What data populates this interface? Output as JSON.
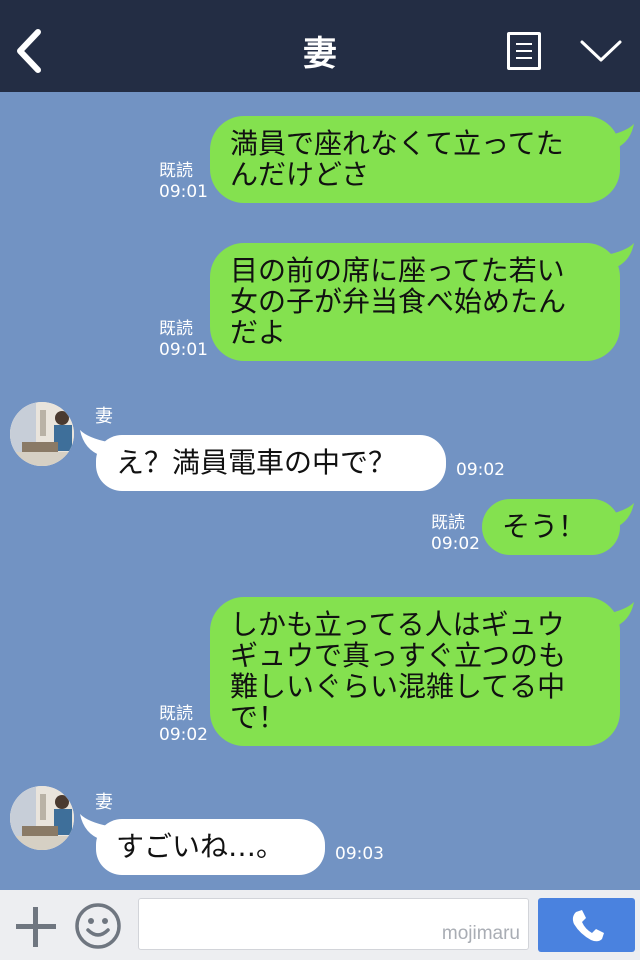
{
  "header": {
    "title": "妻",
    "icons": [
      "back-arrow-icon",
      "notes-icon",
      "chevron-down-icon"
    ]
  },
  "messages": [
    {
      "side": "out",
      "lines": [
        "満員で座れなくて立ってた",
        "んだけどさ"
      ],
      "read": "既読",
      "time": "09:01"
    },
    {
      "side": "out",
      "lines": [
        "目の前の席に座ってた若い",
        "女の子が弁当食べ始めたん",
        "だよ"
      ],
      "read": "既読",
      "time": "09:01"
    },
    {
      "side": "in",
      "sender": "妻",
      "lines": [
        "え？満員電車の中で？"
      ],
      "time": "09:02"
    },
    {
      "side": "out",
      "lines": [
        "そう！"
      ],
      "read": "既読",
      "time": "09:02"
    },
    {
      "side": "out",
      "lines": [
        "しかも立ってる人はギュウ",
        "ギュウで真っすぐ立つのも",
        "難しいぐらい混雑してる中",
        "で！"
      ],
      "read": "既読",
      "time": "09:02"
    },
    {
      "side": "in",
      "sender": "妻",
      "lines": [
        "すごいね…。"
      ],
      "time": "09:03"
    }
  ],
  "input": {
    "watermark": "mojimaru",
    "icons": [
      "plus-icon",
      "smiley-icon",
      "phone-icon"
    ]
  },
  "colors": {
    "header": "#232d44",
    "background": "#7293c3",
    "out_bubble": "#84e14f",
    "in_bubble": "#ffffff",
    "call_button": "#4a82df"
  }
}
